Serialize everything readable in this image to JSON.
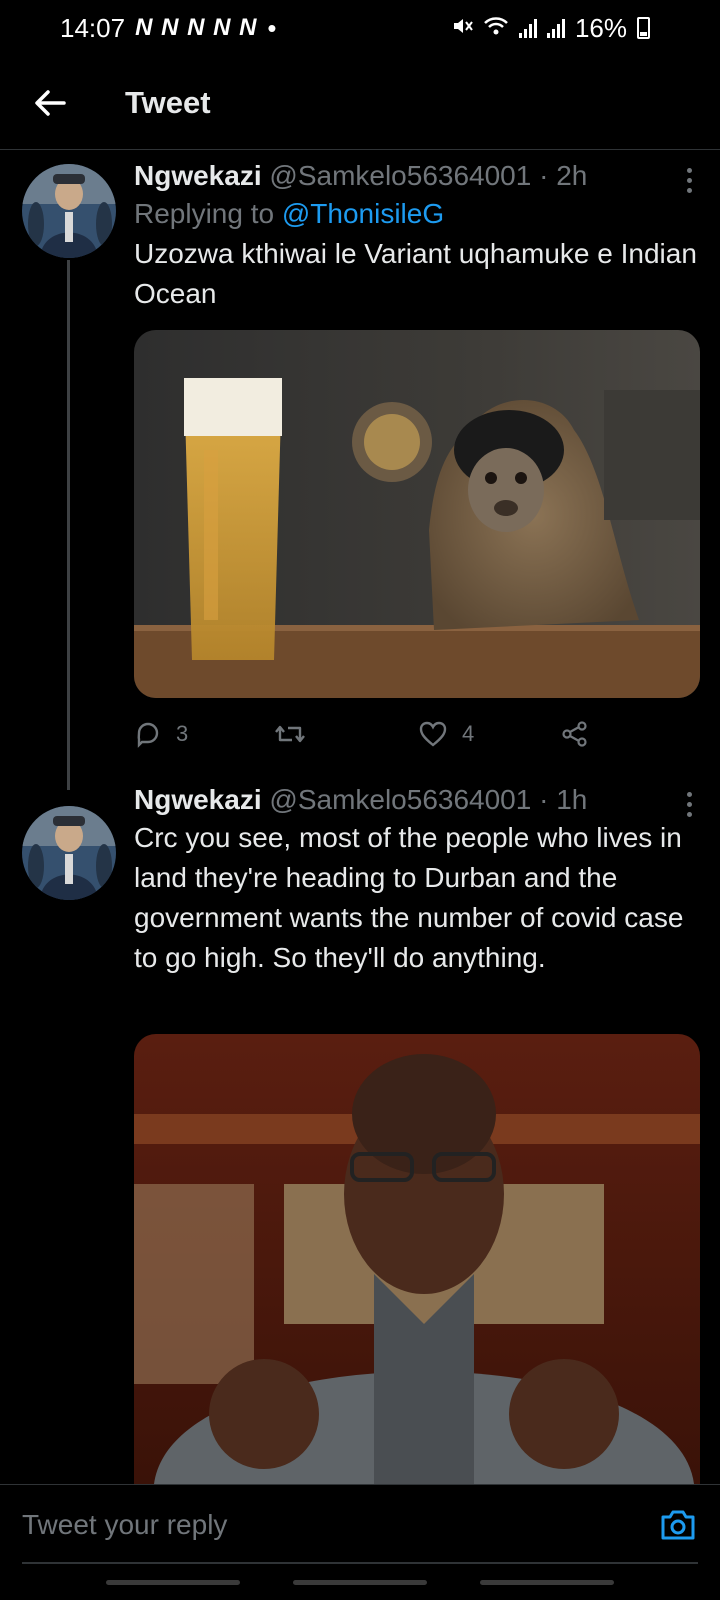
{
  "status_bar": {
    "time": "14:07",
    "notifications": "N N N N N",
    "dot": "•",
    "battery": "16%",
    "icons": [
      "mute-icon",
      "wifi-icon",
      "signal-icon",
      "signal-icon",
      "battery-charging-icon"
    ]
  },
  "header": {
    "title": "Tweet",
    "back_icon": "back-arrow-icon"
  },
  "tweets": [
    {
      "name": "Ngwekazi",
      "handle": "@Samkelo56364001",
      "time": "· 2h",
      "replying_prefix": "Replying to",
      "replying_to": "@ThonisileG",
      "text": "Uzozwa kthiwai le Variant uqhamuke e Indian Ocean",
      "media": "monkey with beer photo",
      "reply_count": "3",
      "retweet_count": "",
      "like_count": "4"
    },
    {
      "name": "Ngwekazi",
      "handle": "@Samkelo56364001",
      "time": "· 1h",
      "text": "Crc you see, most of the people who lives in land they're heading to Durban and the government wants the number of covid case to go high. So they'll do anything.",
      "media": "man speaking photo"
    }
  ],
  "reply_bar": {
    "placeholder": "Tweet your reply"
  },
  "colors": {
    "accent": "#1d9bf0",
    "background": "#000000",
    "muted": "#71767b"
  }
}
